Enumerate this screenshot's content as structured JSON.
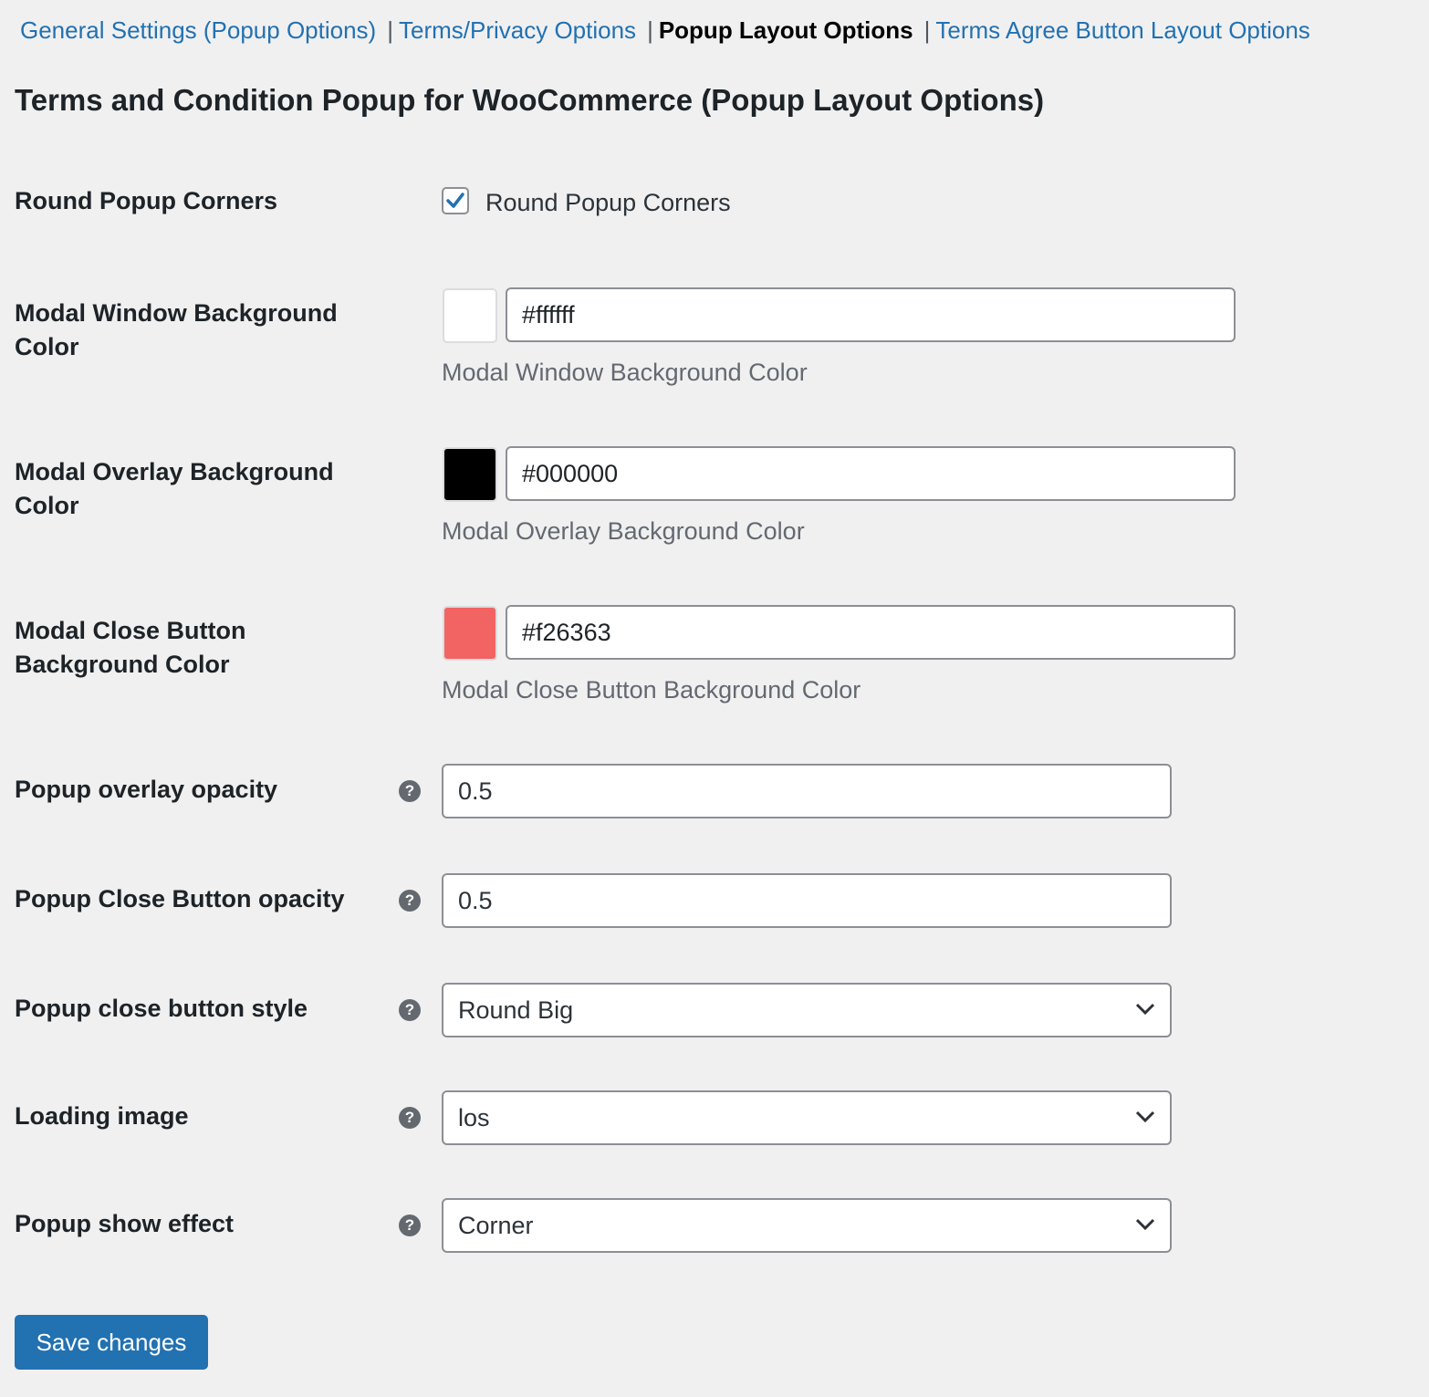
{
  "nav": {
    "tabs": [
      {
        "label": "General Settings (Popup Options)",
        "active": false
      },
      {
        "label": "Terms/Privacy Options",
        "active": false
      },
      {
        "label": "Popup Layout Options",
        "active": true
      },
      {
        "label": "Terms Agree Button Layout Options",
        "active": false
      }
    ],
    "separator": "|"
  },
  "page_title": "Terms and Condition Popup for WooCommerce (Popup Layout Options)",
  "settings": {
    "round_corners": {
      "label": "Round Popup Corners",
      "checkbox_label": "Round Popup Corners",
      "checked": true
    },
    "window_bg": {
      "label": "Modal Window Background Color",
      "value": "#ffffff",
      "swatch_color": "#ffffff",
      "description": "Modal Window Background Color"
    },
    "overlay_bg": {
      "label": "Modal Overlay Background Color",
      "value": "#000000",
      "swatch_color": "#000000",
      "description": "Modal Overlay Background Color"
    },
    "close_bg": {
      "label": "Modal Close Button Background Color",
      "value": "#f26363",
      "swatch_color": "#f26363",
      "description": "Modal Close Button Background Color"
    },
    "overlay_opacity": {
      "label": "Popup overlay opacity",
      "value": "0.5"
    },
    "close_opacity": {
      "label": "Popup Close Button opacity",
      "value": "0.5"
    },
    "close_style": {
      "label": "Popup close button style",
      "selected": "Round Big"
    },
    "loading_image": {
      "label": "Loading image",
      "selected": "los"
    },
    "show_effect": {
      "label": "Popup show effect",
      "selected": "Corner"
    }
  },
  "help_glyph": "?",
  "save_label": "Save changes",
  "colors": {
    "link": "#2271b1",
    "primary_button": "#2271b1",
    "background": "#f0f0f1"
  }
}
